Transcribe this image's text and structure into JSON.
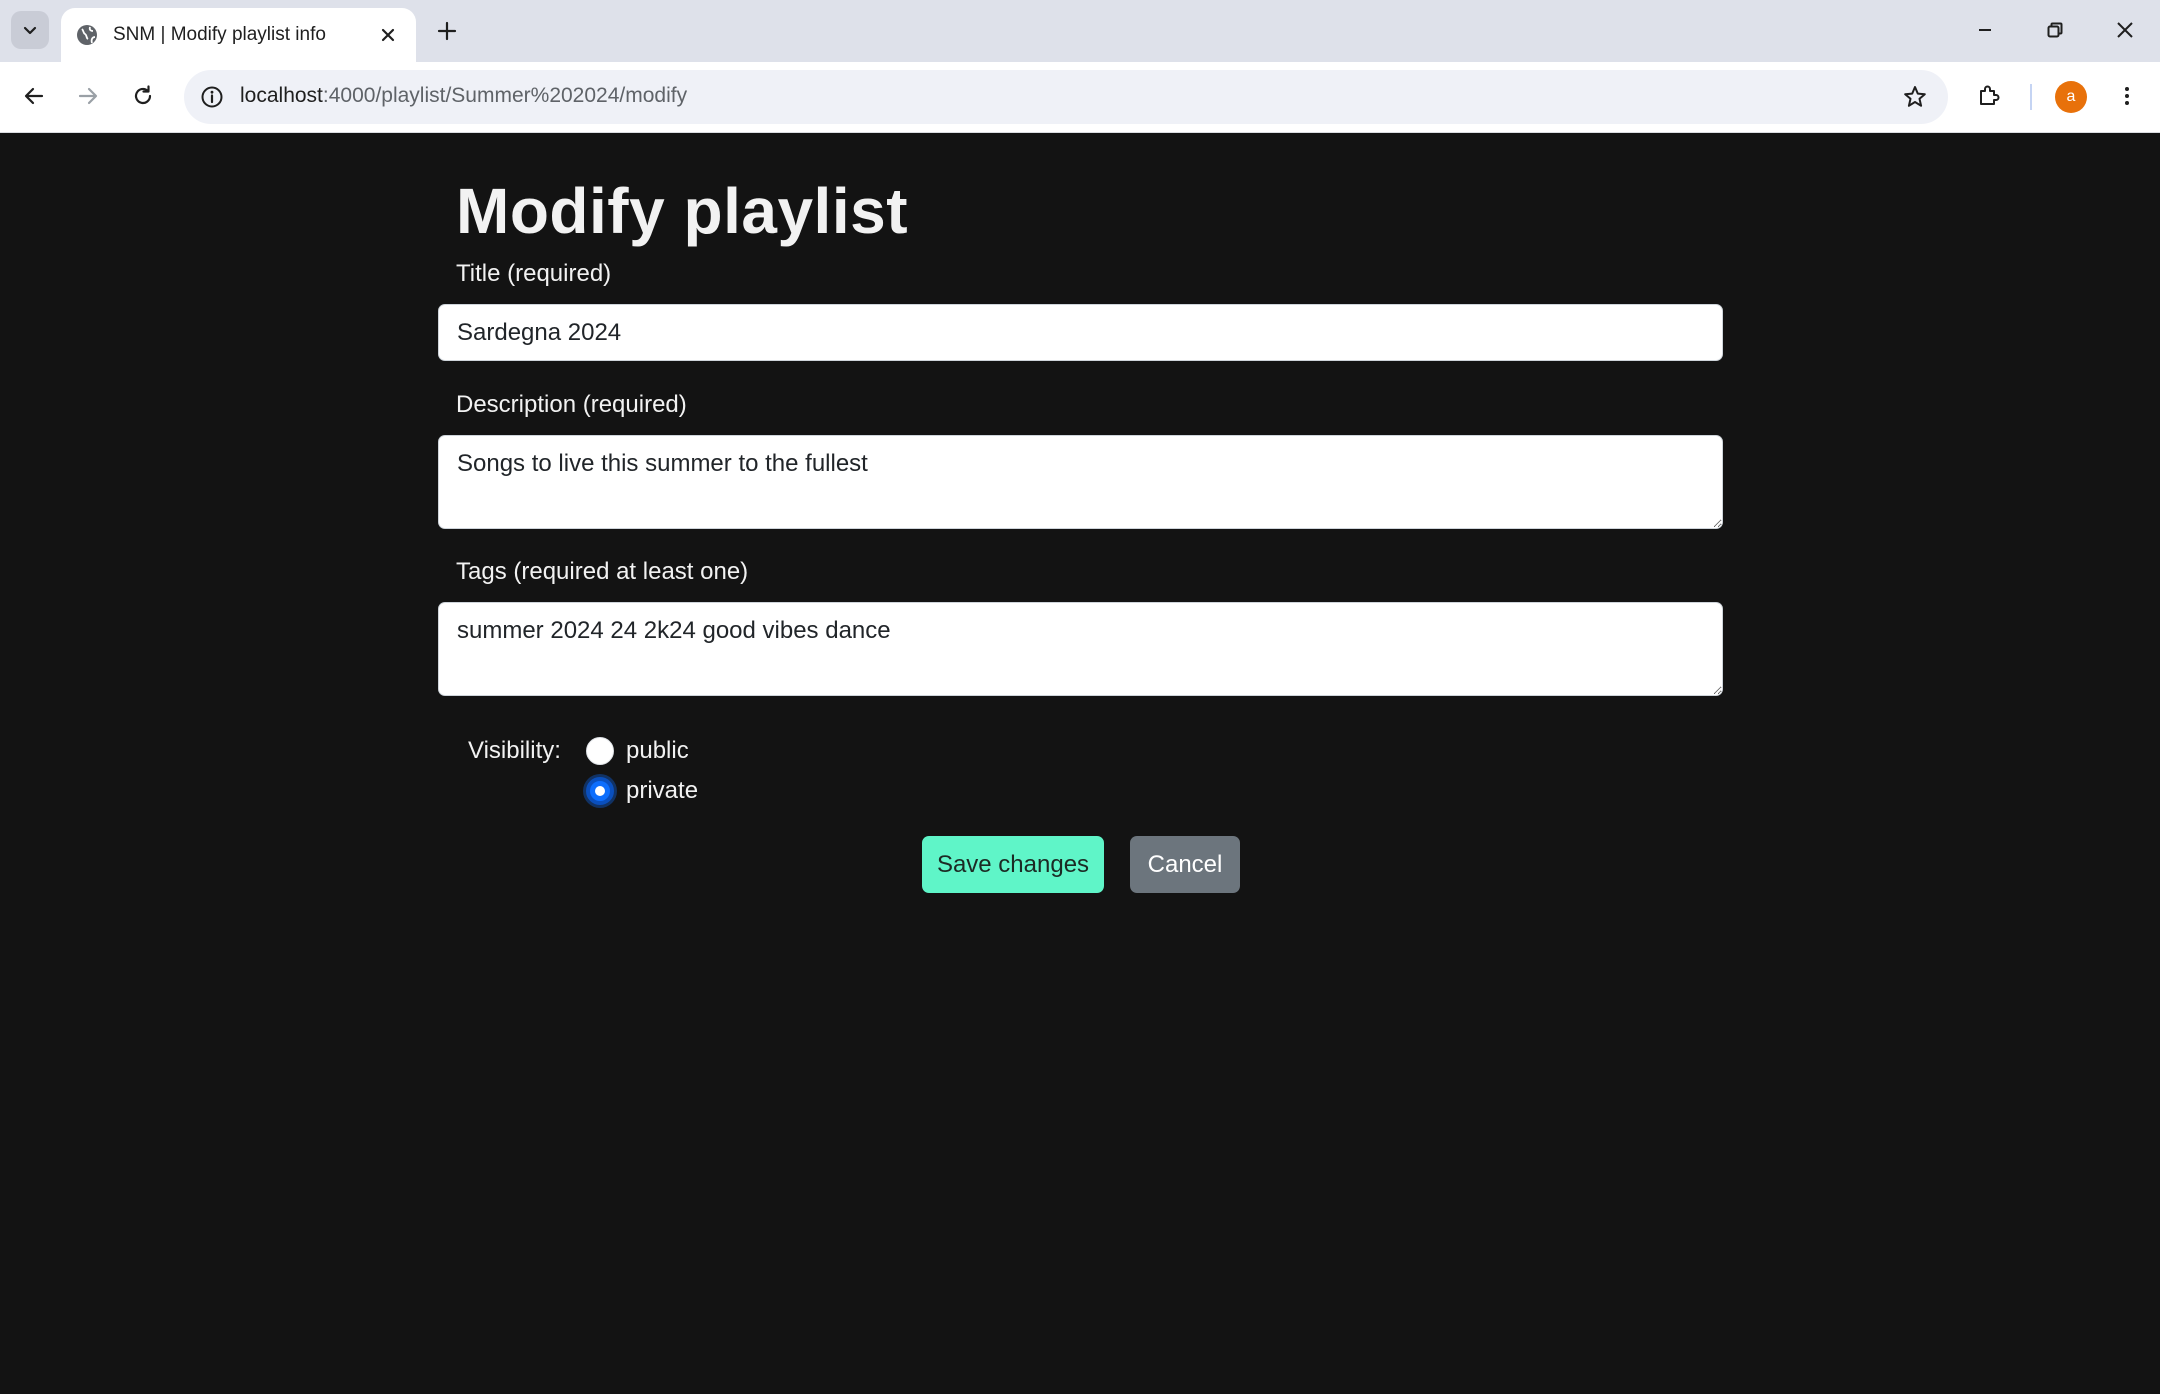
{
  "browser": {
    "tab": {
      "title": "SNM | Modify playlist info",
      "favicon": "globe-icon"
    },
    "address_bar": {
      "host": "localhost",
      "path": ":4000/playlist/Summer%202024/modify"
    },
    "profile_initial": "a"
  },
  "page": {
    "heading": "Modify playlist",
    "title_field": {
      "label": "Title (required)",
      "value": "Sardegna 2024"
    },
    "description_field": {
      "label": "Description (required)",
      "value": "Songs to live this summer to the fullest"
    },
    "tags_field": {
      "label": "Tags (required at least one)",
      "value": "summer 2024 24 2k24 good vibes dance"
    },
    "visibility": {
      "label": "Visibility:",
      "options": [
        {
          "label": "public",
          "checked": false
        },
        {
          "label": "private",
          "checked": true
        }
      ]
    },
    "buttons": {
      "save": "Save changes",
      "cancel": "Cancel"
    }
  },
  "colors": {
    "page_background": "#131313",
    "save_button": "#5ff5c8",
    "cancel_button": "#6c757d",
    "radio_checked": "#0d6efd"
  }
}
